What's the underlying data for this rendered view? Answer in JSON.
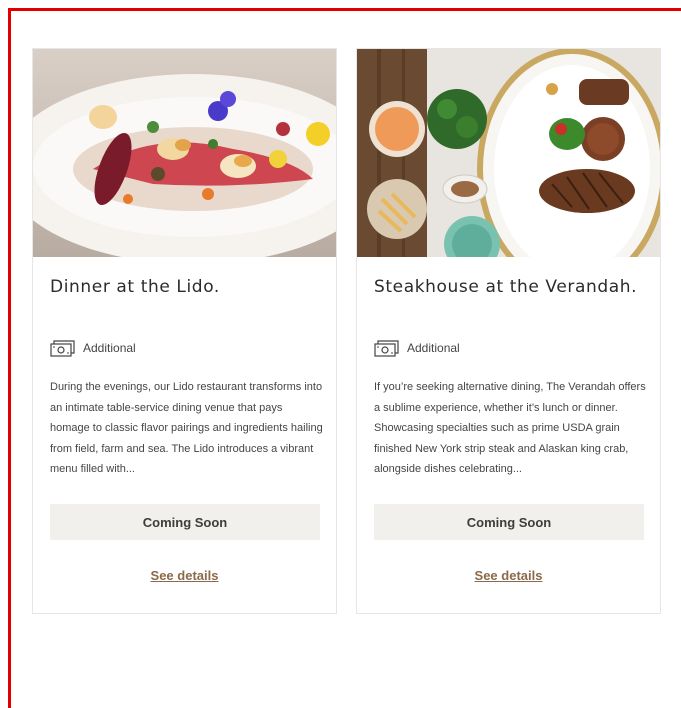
{
  "cards": [
    {
      "title": "Dinner at the Lido.",
      "tag": "Additional",
      "description": "During the evenings, our Lido restaurant transforms into an intimate table-service dining venue that pays homage to classic flavor pairings and ingredients hailing from field, farm and sea. The Lido introduces a vibrant menu filled with...",
      "button": "Coming Soon",
      "link": "See details"
    },
    {
      "title": "Steakhouse at the Verandah.",
      "tag": "Additional",
      "description": "If you’re seeking alternative dining, The Verandah offers a sublime experience, whether it’s lunch or dinner. Showcasing specialties such as prime USDA grain finished New York strip steak and Alaskan king crab, alongside dishes celebrating...",
      "button": "Coming Soon",
      "link": "See details"
    }
  ],
  "colors": {
    "frame": "#e00000",
    "button_bg": "#f2f0ed",
    "link": "#8a6a4a"
  },
  "icons": {
    "tag_icon": "ticket-icon"
  }
}
